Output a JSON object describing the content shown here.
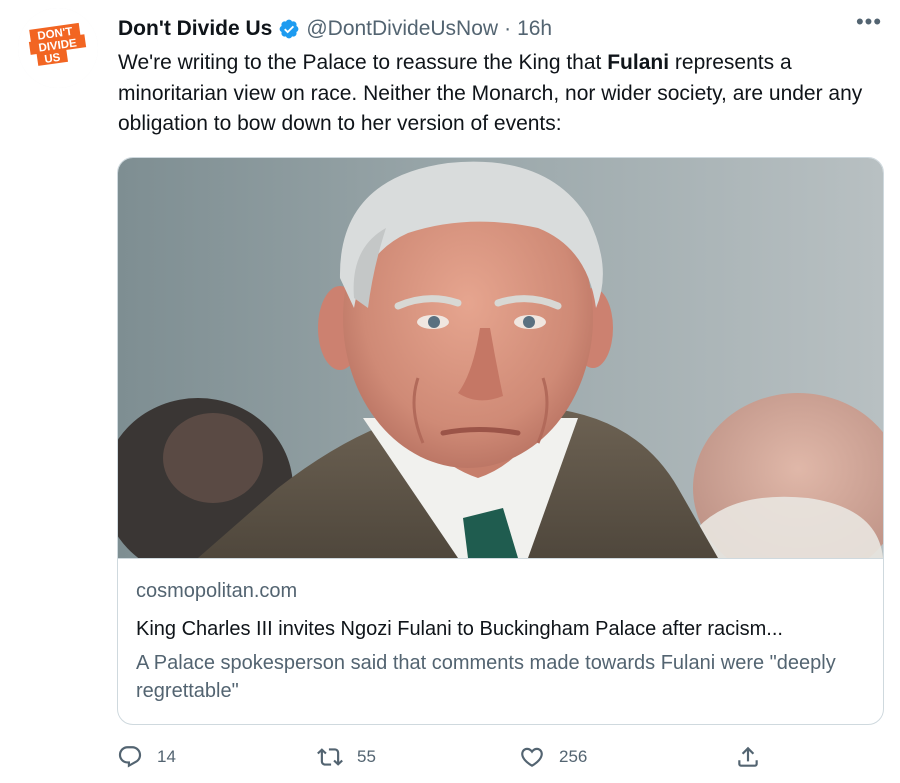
{
  "tweet": {
    "avatar_logo_lines": [
      "DON'T",
      "DIVIDE",
      "US"
    ],
    "display_name": "Don't Divide Us",
    "handle": "@DontDivideUsNow",
    "separator": "·",
    "time": "16h",
    "more_glyph": "•••",
    "text_before_bold": "We're writing to the Palace to reassure the King that ",
    "text_bold": "Fulani",
    "text_after_bold": " represents a minoritarian view on race. Neither the Monarch, nor wider society, are under any obligation  to bow down to her version of events:"
  },
  "card": {
    "domain": "cosmopolitan.com",
    "title": "King Charles III invites Ngozi Fulani to Buckingham Palace after racism...",
    "description": "A Palace spokesperson said that comments made towards Fulani were \"deeply regrettable\""
  },
  "actions": {
    "reply_count": "14",
    "retweet_count": "55",
    "like_count": "256"
  },
  "icons": {
    "verified": "verified-badge-icon",
    "more": "more-icon",
    "reply": "reply-icon",
    "retweet": "retweet-icon",
    "like": "like-icon",
    "share": "share-icon"
  },
  "colors": {
    "brand_orange": "#f26522",
    "verified_blue": "#1d9bf0",
    "text_primary": "#0f1419",
    "text_secondary": "#536471",
    "border": "#cfd9de"
  }
}
